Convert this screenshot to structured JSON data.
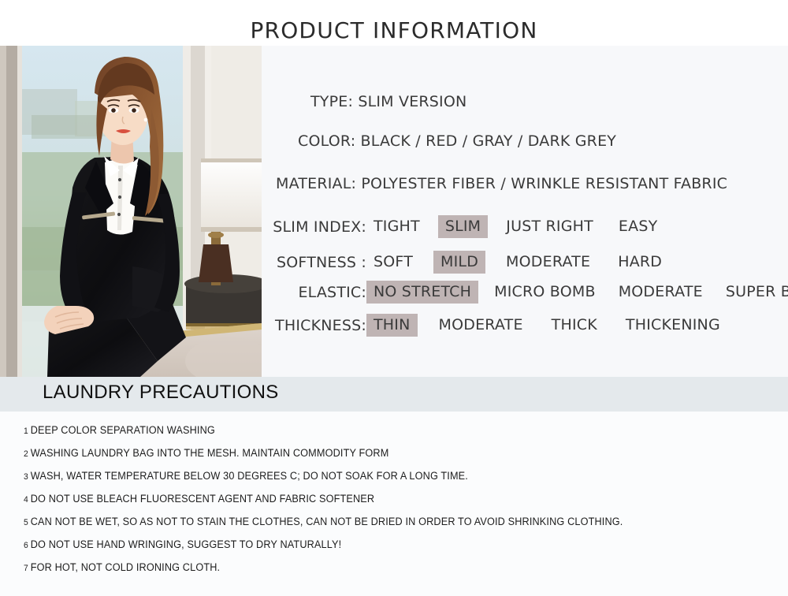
{
  "page": {
    "title": "PRODUCT INFORMATION"
  },
  "colors": {
    "highlight": "#bfb4b4",
    "spec_panel_bg": "#f7f8fa",
    "laundry_header_bg": "#e4e9ec",
    "text": "#3a3a3a"
  },
  "photo": {
    "alt": "model-wearing-black-slim-suit-by-window"
  },
  "spec": {
    "type": "TYPE: SLIM VERSION",
    "color": "COLOR: BLACK / RED / GRAY / DARK GREY",
    "material": "MATERIAL: POLYESTER FIBER / WRINKLE RESISTANT FABRIC",
    "rows": [
      {
        "label": "SLIM INDEX:",
        "options": [
          "TIGHT",
          "SLIM",
          "JUST RIGHT",
          "EASY"
        ],
        "selected": "SLIM"
      },
      {
        "label": "SOFTNESS :",
        "options": [
          "SOFT",
          "MILD",
          "MODERATE",
          "HARD"
        ],
        "selected": "MILD"
      },
      {
        "label": "ELASTIC:",
        "options": [
          "NO STRETCH",
          "MICRO BOMB",
          "MODERATE",
          "SUPER BOMB"
        ],
        "selected": "NO STRETCH"
      },
      {
        "label": "THICKNESS:",
        "options": [
          "THIN",
          "MODERATE",
          "THICK",
          "THICKENING"
        ],
        "selected": "THIN"
      }
    ]
  },
  "laundry": {
    "title": "LAUNDRY PRECAUTIONS",
    "items": [
      {
        "num": "1",
        "text": "DEEP COLOR SEPARATION WASHING"
      },
      {
        "num": "2",
        "text": "WASHING LAUNDRY BAG INTO THE MESH. MAINTAIN COMMODITY FORM"
      },
      {
        "num": "3",
        "text": "WASH, WATER TEMPERATURE BELOW 30 DEGREES C; DO NOT SOAK FOR A LONG TIME."
      },
      {
        "num": "4",
        "text": "DO NOT USE BLEACH FLUORESCENT AGENT AND FABRIC SOFTENER"
      },
      {
        "num": "5",
        "text": "CAN NOT BE WET, SO AS NOT TO STAIN THE CLOTHES, CAN NOT BE DRIED IN ORDER TO AVOID SHRINKING CLOTHING."
      },
      {
        "num": "6",
        "text": "DO NOT USE HAND WRINGING, SUGGEST TO DRY NATURALLY!"
      },
      {
        "num": "7",
        "text": "FOR HOT, NOT COLD IRONING CLOTH."
      }
    ]
  }
}
